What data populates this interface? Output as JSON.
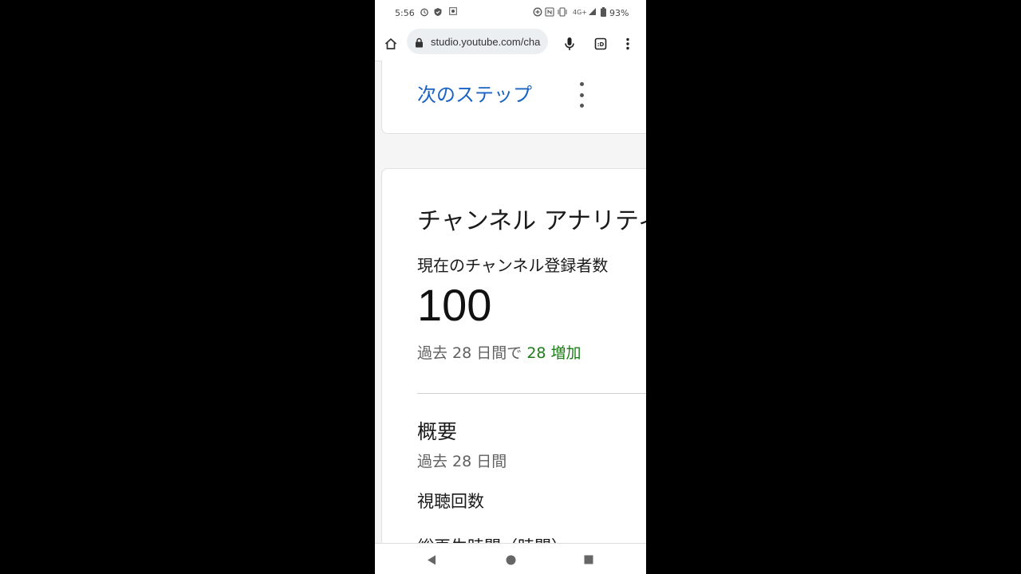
{
  "status_bar": {
    "time": "5:56",
    "network": "4G+",
    "battery": "93%",
    "icons": [
      "alarm-icon",
      "shield-icon",
      "screen-record-icon",
      "data-saver-icon",
      "nfc-icon",
      "vibrate-icon",
      "signal-icon",
      "battery-icon"
    ]
  },
  "browser": {
    "url": "studio.youtube.com/cha",
    "icons": [
      "home-icon",
      "lock-icon",
      "mic-icon",
      "tab-switcher-icon",
      "more-vert-icon"
    ],
    "tab_count": ":D"
  },
  "card_next_steps": {
    "title": "次のステップ"
  },
  "card_analytics": {
    "title": "チャンネル アナリティクス",
    "subscribers_label": "現在のチャンネル登録者数",
    "subscribers_count": "100",
    "change_prefix": "過去 28 日間で",
    "change_value": "28 増加",
    "summary_title": "概要",
    "summary_period": "過去 28 日間",
    "metric_views": "視聴回数",
    "metric_watch_time": "総再生時間（時間）"
  },
  "colors": {
    "link_blue": "#1a63c4",
    "gain_green": "#1e7d18",
    "text_primary": "#1a1a1a",
    "text_secondary": "#606060"
  },
  "nav_bar": {
    "icons": [
      "back-icon",
      "home-circle-icon",
      "recents-icon"
    ]
  }
}
